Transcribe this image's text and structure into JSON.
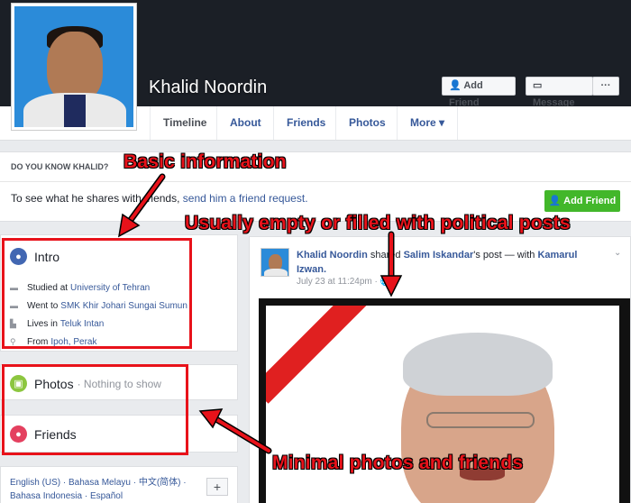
{
  "profile": {
    "name": "Khalid Noordin",
    "buttons": {
      "add_friend": "Add Friend",
      "message": "Message",
      "more": "···"
    }
  },
  "tabs": [
    {
      "label": "Timeline"
    },
    {
      "label": "About"
    },
    {
      "label": "Friends"
    },
    {
      "label": "Photos"
    },
    {
      "label": "More ▾"
    }
  ],
  "know": {
    "heading": "DO YOU KNOW KHALID?",
    "text_before": "To see what he shares with friends,",
    "link": "send him a friend request.",
    "button": "Add Friend"
  },
  "intro": {
    "title": "Intro",
    "items": [
      {
        "icon": "graduation-icon",
        "prefix": "Studied at",
        "link": "University of Tehran"
      },
      {
        "icon": "school-icon",
        "prefix": "Went to",
        "link": "SMK Khir Johari Sungai Sumun"
      },
      {
        "icon": "home-icon",
        "prefix": "Lives in",
        "link": "Teluk Intan"
      },
      {
        "icon": "pin-icon",
        "prefix": "From",
        "link": "Ipoh, Perak"
      }
    ]
  },
  "photos": {
    "title": "Photos",
    "empty": "· Nothing to show"
  },
  "friends": {
    "title": "Friends"
  },
  "languages": {
    "text": "English (US) · Bahasa Melayu · 中文(简体) · Bahasa Indonesia · Español",
    "plus": "+"
  },
  "post": {
    "author": "Khalid Noordin",
    "action": "shared",
    "source": "Salim Iskandar",
    "source_suffix": "'s post — with",
    "with": "Kamarul Izwan.",
    "time": "July 23 at 11:24pm · 🌐",
    "caret": "⌄"
  },
  "annotations": {
    "basic": "Basic information",
    "empty": "Usually empty or filled with political posts",
    "minimal": "Minimal photos and friends"
  },
  "colors": {
    "link": "#365899",
    "green": "#42b72a",
    "annotation_red": "#e8121a",
    "cover": "#1b1f26"
  }
}
